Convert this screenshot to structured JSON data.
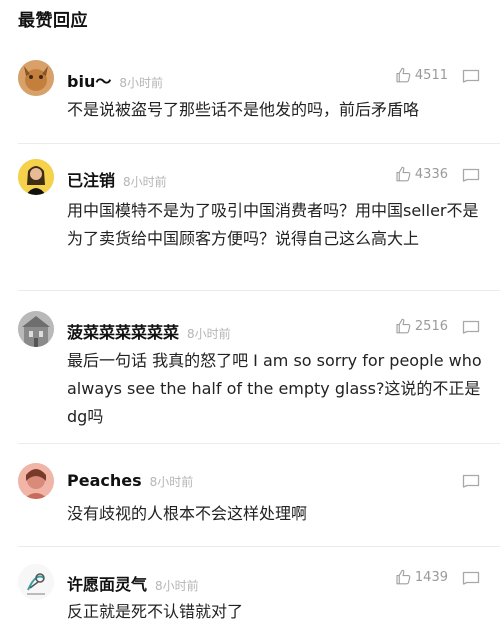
{
  "section_title": "最赞回应",
  "comments": [
    {
      "username": "biu～",
      "time": "8小时前",
      "likes": "4511",
      "text": "不是说被盗号了那些话不是他发的吗，前后矛盾咯"
    },
    {
      "username": "已注销",
      "time": "8小时前",
      "likes": "4336",
      "text": "用中国模特不是为了吸引中国消费者吗？用中国seller不是为了卖货给中国顾客方便吗？说得自己这么高大上"
    },
    {
      "username": "菠菜菜菜菜菜菜",
      "time": "8小时前",
      "likes": "2516",
      "text": "最后一句话 我真的怒了吧 I am so sorry for people who always see the half of the empty glass?这说的不正是dg吗"
    },
    {
      "username": "Peaches",
      "time": "8小时前",
      "likes": "",
      "text": "没有歧视的人根本不会这样处理啊"
    },
    {
      "username": "许愿面灵气",
      "time": "8小时前",
      "likes": "1439",
      "text": "反正就是死不认错就对了"
    }
  ],
  "icons": {
    "like": "thumbs-up-icon",
    "reply": "comment-bubble-icon"
  }
}
